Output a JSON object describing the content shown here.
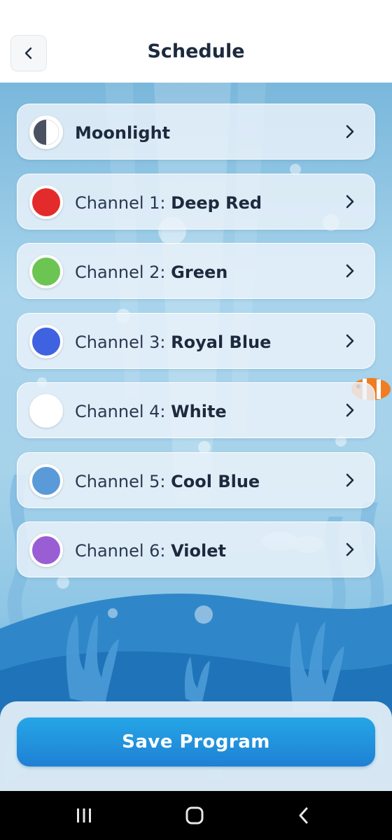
{
  "header": {
    "title": "Schedule",
    "back_icon": "chevron-left-icon"
  },
  "channels": [
    {
      "prefix": "",
      "name": "Moonlight",
      "color": "#4a5160",
      "icon": "half-moon-icon"
    },
    {
      "prefix": "Channel 1:",
      "name": "Deep Red",
      "color": "#e32b2b"
    },
    {
      "prefix": "Channel 2:",
      "name": "Green",
      "color": "#6cc553"
    },
    {
      "prefix": "Channel 3:",
      "name": "Royal Blue",
      "color": "#3f62e0"
    },
    {
      "prefix": "Channel 4:",
      "name": "White",
      "color": "#ffffff"
    },
    {
      "prefix": "Channel 5:",
      "name": "Cool Blue",
      "color": "#5b9ad8"
    },
    {
      "prefix": "Channel 6:",
      "name": "Violet",
      "color": "#9a5ed4"
    }
  ],
  "footer": {
    "save_label": "Save Program",
    "accent": "#1f86d8"
  },
  "navbar": {
    "recent_icon": "recent-apps-icon",
    "home_icon": "home-icon",
    "back_icon": "back-icon"
  }
}
